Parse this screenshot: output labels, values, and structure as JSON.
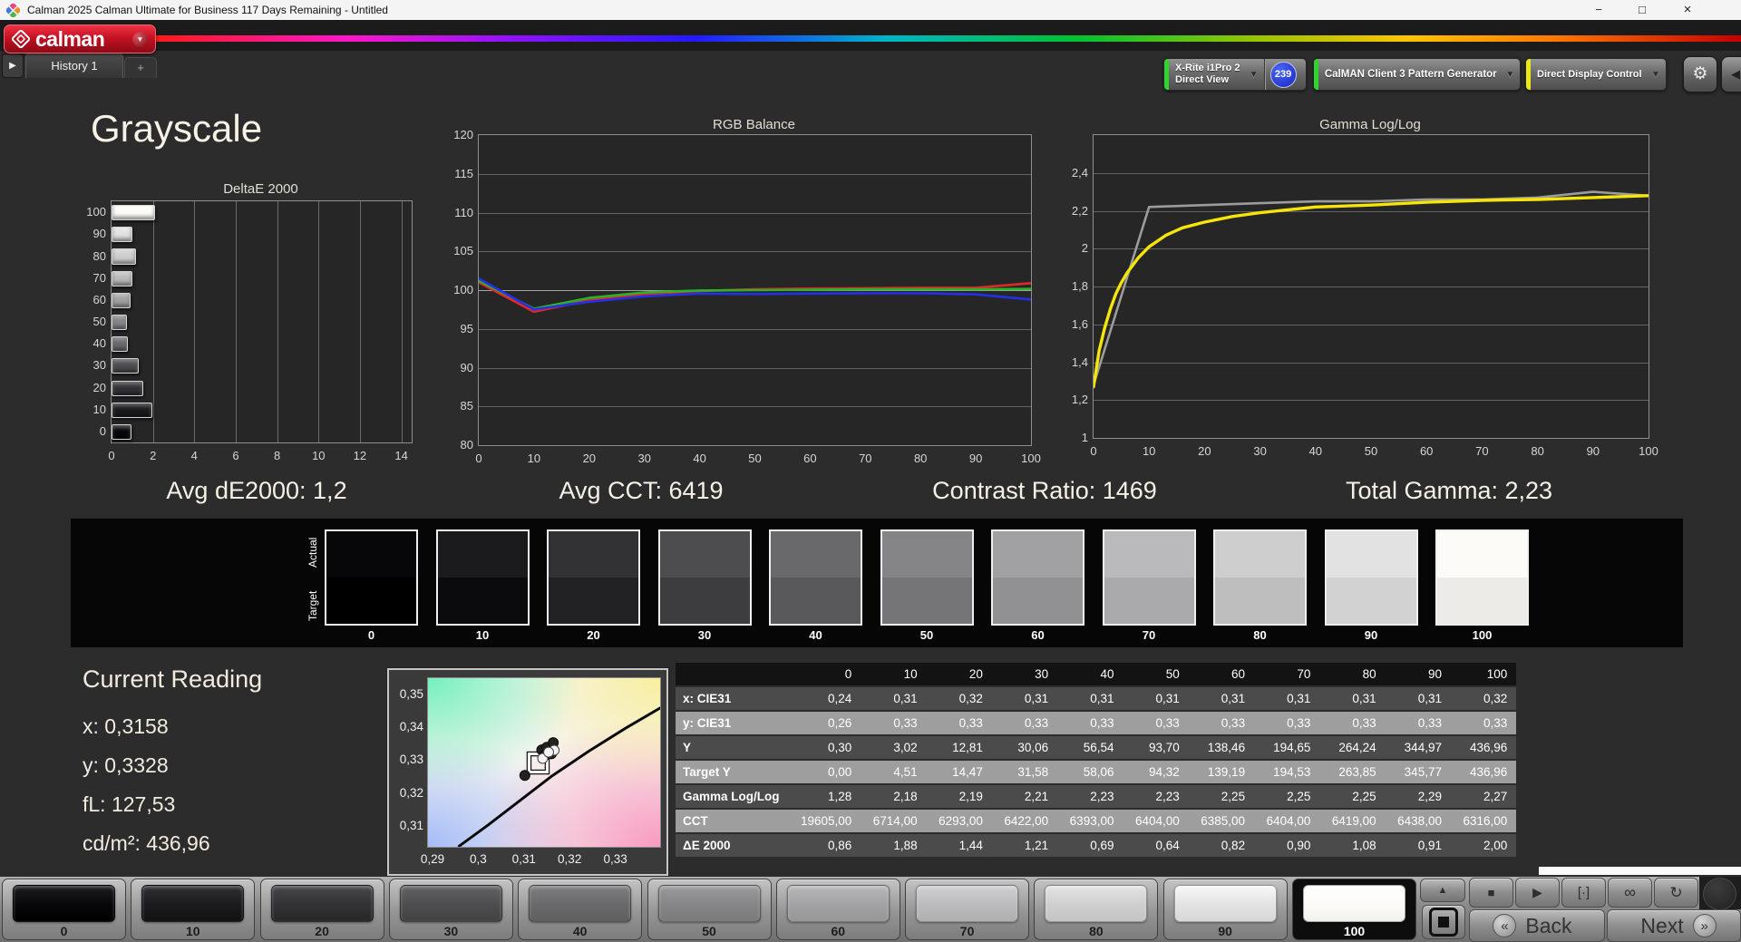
{
  "window": {
    "title": "Calman 2025 Calman Ultimate for Business 117 Days Remaining  - Untitled",
    "minimize_icon": "−",
    "maximize_icon": "□",
    "close_icon": "×"
  },
  "header": {
    "logo_text": "calman"
  },
  "icons": {
    "dropdown_arrow": "▼",
    "up_arrow": "▲",
    "collapse_left": "◀",
    "gear": "⚙",
    "tab_expand": "▶",
    "stop": "■",
    "play": "▶",
    "single_pattern": "[·]",
    "infinity": "∞",
    "refresh": "↻",
    "back_chevron": "«",
    "next_chevron": "»",
    "add_tab": "+"
  },
  "tabs": {
    "history": "History 1"
  },
  "toolbar": {
    "meter": {
      "line1": "X-Rite i1Pro 2",
      "line2": "Direct View",
      "badge": "239",
      "stripe_color": "#2fd42f"
    },
    "pattern_generator": {
      "label": "CalMAN Client 3 Pattern Generator",
      "stripe_color": "#2fd42f"
    },
    "display_control": {
      "label": "Direct Display Control",
      "stripe_color": "#e8e818"
    }
  },
  "page": {
    "title": "Grayscale"
  },
  "stats": {
    "de2000": "Avg dE2000: 1,2",
    "cct": "Avg CCT: 6419",
    "contrast": "Contrast Ratio: 1469",
    "total_gamma": "Total Gamma: 2,23"
  },
  "swatch_strip": {
    "actual_label": "Actual",
    "target_label": "Target"
  },
  "grayscale_levels": [
    {
      "label": "0",
      "color": "#07070a"
    },
    {
      "label": "10",
      "color": "#1b1b1e"
    },
    {
      "label": "20",
      "color": "#323235"
    },
    {
      "label": "30",
      "color": "#4d4d50"
    },
    {
      "label": "40",
      "color": "#69696c"
    },
    {
      "label": "50",
      "color": "#858588"
    },
    {
      "label": "60",
      "color": "#a1a1a3"
    },
    {
      "label": "70",
      "color": "#bababc"
    },
    {
      "label": "80",
      "color": "#cececf"
    },
    {
      "label": "90",
      "color": "#e2e2e3"
    },
    {
      "label": "100",
      "color": "#fcfbf7"
    }
  ],
  "current_reading": {
    "title": "Current Reading",
    "x": "x: 0,3158",
    "y": "y: 0,3328",
    "fl": "fL: 127,53",
    "cdm2": "cd/m²: 436,96"
  },
  "table": {
    "columns": [
      "0",
      "10",
      "20",
      "30",
      "40",
      "50",
      "60",
      "70",
      "80",
      "90",
      "100"
    ],
    "rows": [
      {
        "label": "x: CIE31",
        "shade": "dark",
        "values": [
          "0,24",
          "0,31",
          "0,32",
          "0,31",
          "0,31",
          "0,31",
          "0,31",
          "0,31",
          "0,31",
          "0,31",
          "0,32"
        ]
      },
      {
        "label": "y: CIE31",
        "shade": "light",
        "values": [
          "0,26",
          "0,33",
          "0,33",
          "0,33",
          "0,33",
          "0,33",
          "0,33",
          "0,33",
          "0,33",
          "0,33",
          "0,33"
        ]
      },
      {
        "label": "Y",
        "shade": "dark",
        "values": [
          "0,30",
          "3,02",
          "12,81",
          "30,06",
          "56,54",
          "93,70",
          "138,46",
          "194,65",
          "264,24",
          "344,97",
          "436,96"
        ]
      },
      {
        "label": "Target Y",
        "shade": "light",
        "values": [
          "0,00",
          "4,51",
          "14,47",
          "31,58",
          "58,06",
          "94,32",
          "139,19",
          "194,53",
          "263,85",
          "345,77",
          "436,96"
        ]
      },
      {
        "label": "Gamma Log/Log",
        "shade": "dark",
        "values": [
          "1,28",
          "2,18",
          "2,19",
          "2,21",
          "2,23",
          "2,23",
          "2,25",
          "2,25",
          "2,25",
          "2,29",
          "2,27"
        ]
      },
      {
        "label": "CCT",
        "shade": "light",
        "values": [
          "19605,00",
          "6714,00",
          "6293,00",
          "6422,00",
          "6393,00",
          "6404,00",
          "6385,00",
          "6404,00",
          "6419,00",
          "6438,00",
          "6316,00"
        ]
      },
      {
        "label": "ΔE 2000",
        "shade": "dark",
        "values": [
          "0,86",
          "1,88",
          "1,44",
          "1,21",
          "0,69",
          "0,64",
          "0,82",
          "0,90",
          "1,08",
          "0,91",
          "2,00"
        ]
      }
    ]
  },
  "chart_data": [
    {
      "id": "deltae",
      "type": "bar",
      "orientation": "horizontal",
      "title": "DeltaE 2000",
      "categories": [
        "0",
        "10",
        "20",
        "30",
        "40",
        "50",
        "60",
        "70",
        "80",
        "90",
        "100"
      ],
      "values": [
        0.86,
        1.88,
        1.44,
        1.21,
        0.69,
        0.64,
        0.82,
        0.9,
        1.08,
        0.91,
        2.0
      ],
      "xlim": [
        0,
        14.5
      ],
      "xticks": [
        0,
        2,
        4,
        6,
        8,
        10,
        12,
        14
      ]
    },
    {
      "id": "rgb_balance",
      "type": "line",
      "title": "RGB Balance",
      "x": [
        0,
        10,
        20,
        30,
        40,
        50,
        60,
        70,
        80,
        90,
        100
      ],
      "xticks": [
        0,
        10,
        20,
        30,
        40,
        50,
        60,
        70,
        80,
        90,
        100
      ],
      "ylim": [
        80,
        120
      ],
      "yticks": [
        120,
        115,
        110,
        105,
        100,
        95,
        90,
        85,
        80
      ],
      "reference_line": 100,
      "series": [
        {
          "name": "Red",
          "color": "#e02828",
          "values": [
            101.0,
            97.2,
            98.7,
            99.5,
            99.9,
            100.1,
            100.2,
            100.25,
            100.3,
            100.3,
            100.9
          ]
        },
        {
          "name": "Green",
          "color": "#28b428",
          "values": [
            101.2,
            97.6,
            99.0,
            99.7,
            99.95,
            100.0,
            100.05,
            100.1,
            100.1,
            100.1,
            100.15
          ]
        },
        {
          "name": "Blue",
          "color": "#2430e8",
          "values": [
            101.5,
            97.5,
            98.5,
            99.2,
            99.55,
            99.5,
            99.55,
            99.6,
            99.6,
            99.45,
            98.8
          ]
        }
      ]
    },
    {
      "id": "gamma",
      "type": "line",
      "title": "Gamma Log/Log",
      "ylim": [
        1,
        2.6
      ],
      "yticks": [
        2.4,
        2.2,
        2.0,
        1.8,
        1.6,
        1.4,
        1.2,
        1.0
      ],
      "ytick_labels": [
        "2,4",
        "2,2",
        "2",
        "1,8",
        "1,6",
        "1,4",
        "1,2",
        "1"
      ],
      "xticks": [
        0,
        10,
        20,
        30,
        40,
        50,
        60,
        70,
        80,
        90,
        100
      ],
      "series": [
        {
          "name": "Target Gamma",
          "color": "#9c9c9c",
          "points": [
            [
              0,
              1.28
            ],
            [
              10,
              2.22
            ],
            [
              20,
              2.23
            ],
            [
              30,
              2.24
            ],
            [
              40,
              2.25
            ],
            [
              50,
              2.25
            ],
            [
              60,
              2.26
            ],
            [
              70,
              2.26
            ],
            [
              80,
              2.27
            ],
            [
              90,
              2.3
            ],
            [
              100,
              2.28
            ]
          ]
        },
        {
          "name": "Measured Gamma",
          "color": "#f6e50a",
          "points": [
            [
              0,
              1.27
            ],
            [
              1,
              1.46
            ],
            [
              2,
              1.58
            ],
            [
              3,
              1.68
            ],
            [
              4,
              1.76
            ],
            [
              5,
              1.82
            ],
            [
              6,
              1.87
            ],
            [
              8,
              1.95
            ],
            [
              10,
              2.01
            ],
            [
              13,
              2.07
            ],
            [
              16,
              2.11
            ],
            [
              20,
              2.14
            ],
            [
              25,
              2.17
            ],
            [
              30,
              2.19
            ],
            [
              40,
              2.22
            ],
            [
              50,
              2.23
            ],
            [
              60,
              2.245
            ],
            [
              70,
              2.255
            ],
            [
              80,
              2.26
            ],
            [
              90,
              2.27
            ],
            [
              100,
              2.28
            ]
          ]
        }
      ]
    },
    {
      "id": "cie",
      "type": "scatter",
      "xlim": [
        0.2888,
        0.3396
      ],
      "ylim": [
        0.3038,
        0.3553
      ],
      "xticks": [
        0.29,
        0.3,
        0.31,
        0.32,
        0.33
      ],
      "xtick_labels": [
        "0,29",
        "0,3",
        "0,31",
        "0,32",
        "0,33"
      ],
      "yticks": [
        0.35,
        0.34,
        0.33,
        0.32,
        0.31
      ],
      "ytick_labels": [
        "0,35",
        "0,34",
        "0,33",
        "0,32",
        "0,31"
      ],
      "daylight_locus": [
        [
          0.2956,
          0.304
        ],
        [
          0.302,
          0.3105
        ],
        [
          0.309,
          0.318
        ],
        [
          0.316,
          0.3255
        ],
        [
          0.324,
          0.333
        ],
        [
          0.332,
          0.34
        ],
        [
          0.3396,
          0.3462
        ]
      ],
      "measured_points": [
        {
          "x": 0.31,
          "y": 0.3256,
          "style": "dark"
        },
        {
          "x": 0.3137,
          "y": 0.3334,
          "style": "dark"
        },
        {
          "x": 0.3148,
          "y": 0.3342,
          "style": "dark"
        },
        {
          "x": 0.3162,
          "y": 0.3356,
          "style": "dark"
        },
        {
          "x": 0.3158,
          "y": 0.3322,
          "style": "dark"
        },
        {
          "x": 0.3143,
          "y": 0.3316,
          "style": "dark"
        },
        {
          "x": 0.3139,
          "y": 0.3308,
          "style": "white"
        },
        {
          "x": 0.3164,
          "y": 0.3333,
          "style": "white"
        },
        {
          "x": 0.3152,
          "y": 0.3327,
          "style": "white"
        }
      ],
      "target_point": {
        "x": 0.3129,
        "y": 0.3294,
        "marker": "square"
      }
    }
  ],
  "bottom_bar": {
    "selected_level": "100",
    "back_label": "Back",
    "next_label": "Next"
  }
}
